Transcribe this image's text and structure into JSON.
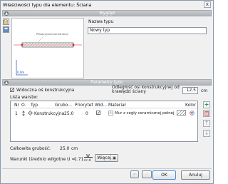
{
  "window": {
    "title": "Właściwości typu dla elementu: Ściana",
    "close_glyph": "x"
  },
  "sections": {
    "preview": "Wygląd",
    "params": "Parametry typu"
  },
  "preview": {
    "annotation": "Płaszczyzna konstrukcji",
    "label_left": "0,0m"
  },
  "type_name": {
    "label": "Nazwa typu",
    "value": "Nowy typ"
  },
  "params": {
    "show_axis_label": "Widoczna oś konstrukcyjna",
    "offset_label": "Odległość osi konstrukcyjnej od krawędzi ściany",
    "offset_value": "12.5",
    "offset_unit": "cm",
    "layers_label": "Lista warstw:"
  },
  "table": {
    "headers": [
      "Nr",
      "O.",
      "Typ",
      "Grubo...",
      "Priorytet",
      "Wid...",
      "Materiał",
      "Kolor"
    ],
    "rows": [
      {
        "nr": "1",
        "type": "Konstrukcyjna",
        "thickness": "25.0",
        "priority": "0",
        "material": "Mur z cegły ceramicznej pełnej"
      }
    ]
  },
  "totals": {
    "label": "Całkowita grubość:",
    "value": "25.0",
    "unit": "cm"
  },
  "conditions": {
    "label": "Warunki (średnio wilgotne U =",
    "value": "1.71",
    "unit_top": "W",
    "unit_bottom": "m²·K",
    "more_button": "Więcej"
  },
  "footer": {
    "ok": "OK",
    "cancel": "Anuluj"
  },
  "colors": {
    "accent": "#1f8f2b",
    "header": "#b0b3b8",
    "highlight": "#4d8fd9"
  }
}
